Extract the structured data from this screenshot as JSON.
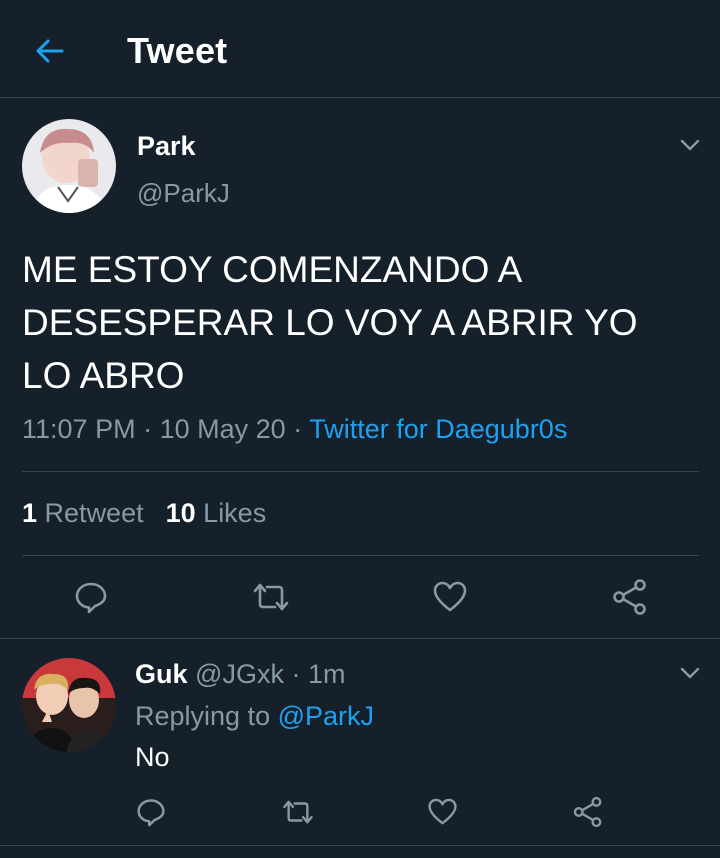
{
  "header": {
    "title": "Tweet"
  },
  "tweet": {
    "author_name": "Park",
    "author_handle": "@ParkJ",
    "text": "ME ESTOY COMENZANDO A\nDESESPERAR LO VOY A ABRIR YO\nLO ABRO",
    "time": "11:07 PM",
    "date": "10 May 20",
    "separator": "·",
    "source": "Twitter for Daegubr0s",
    "retweet_count": "1",
    "retweet_label": "Retweet",
    "like_count": "10",
    "like_label": "Likes"
  },
  "reply": {
    "author_name": "Guk",
    "author_handle": "@JGxk",
    "separator": "·",
    "age": "1m",
    "replying_label": "Replying to",
    "replying_to": "@ParkJ",
    "text": "No"
  },
  "colors": {
    "background": "#15202b",
    "accent": "#1da1f2",
    "secondary_text": "#8899a6",
    "divider": "#38444d"
  }
}
